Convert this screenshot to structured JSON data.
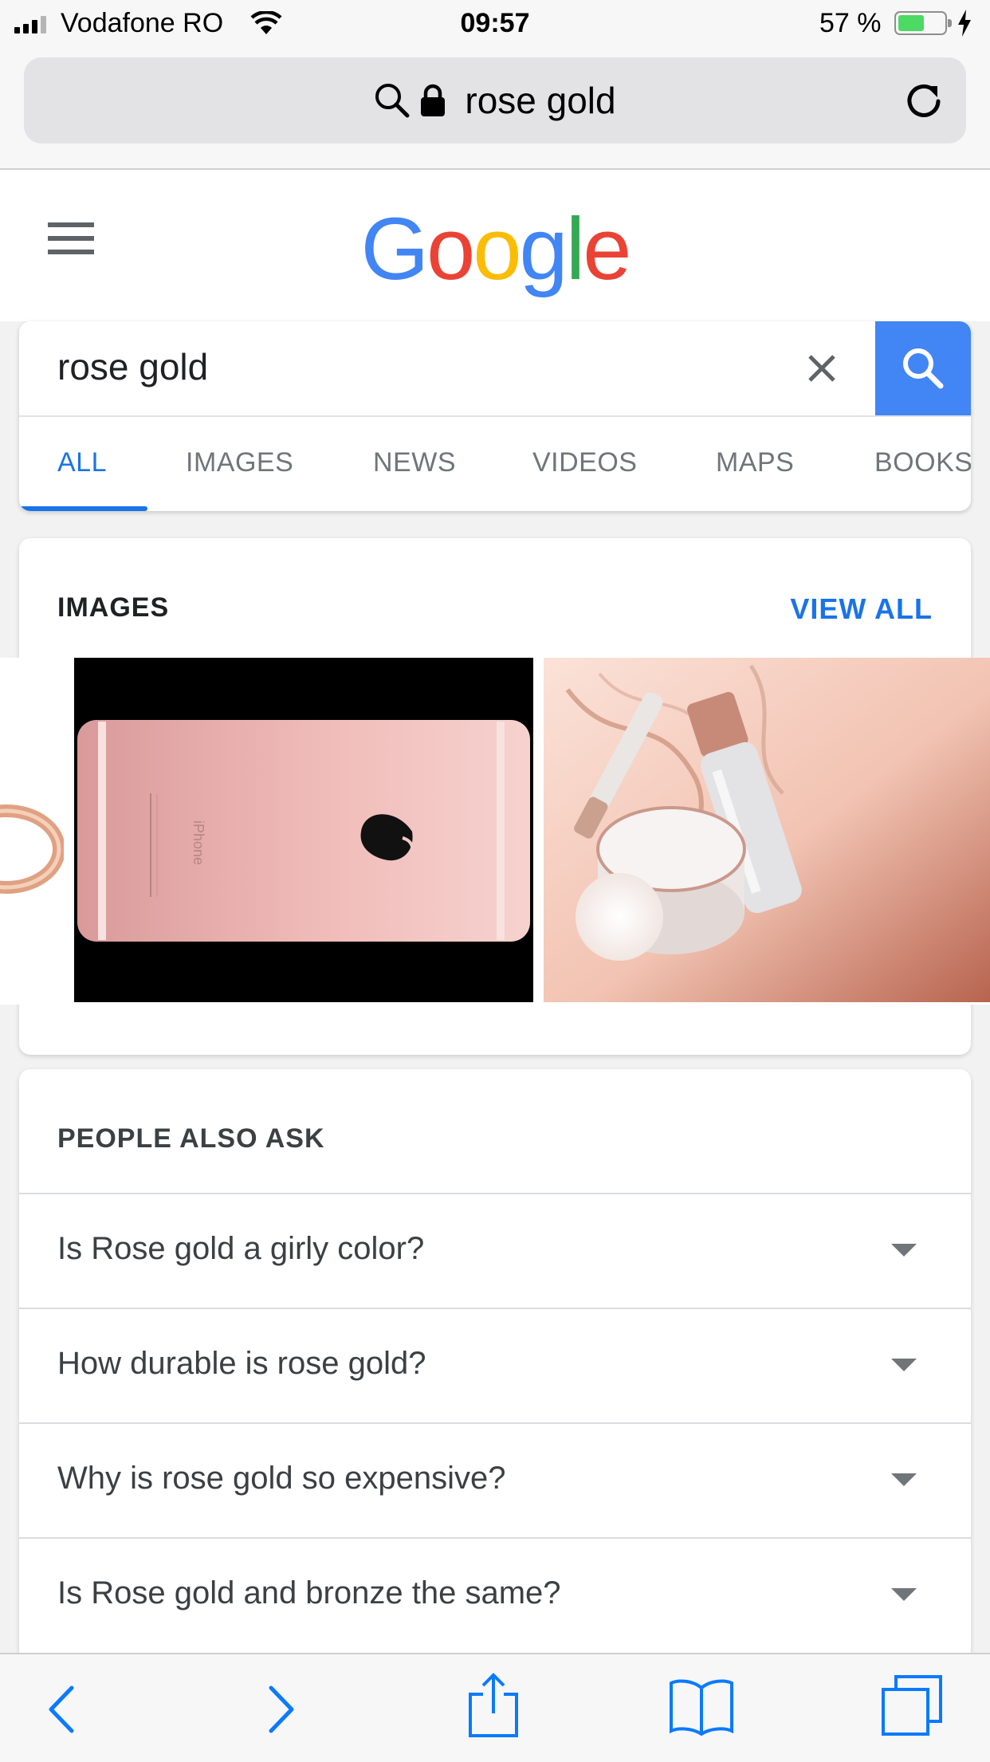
{
  "status_bar": {
    "carrier": "Vodafone RO",
    "time": "09:57",
    "battery_percent": "57 %",
    "battery_level": 0.57
  },
  "browser": {
    "url_text": "rose gold"
  },
  "google": {
    "logo_letters": [
      {
        "char": "G",
        "color": "#4285f4"
      },
      {
        "char": "o",
        "color": "#ea4335"
      },
      {
        "char": "o",
        "color": "#fbbc05"
      },
      {
        "char": "g",
        "color": "#4285f4"
      },
      {
        "char": "l",
        "color": "#34a853"
      },
      {
        "char": "e",
        "color": "#ea4335"
      }
    ],
    "search_query": "rose gold",
    "tabs": [
      {
        "label": "ALL",
        "active": true
      },
      {
        "label": "IMAGES",
        "active": false
      },
      {
        "label": "NEWS",
        "active": false
      },
      {
        "label": "VIDEOS",
        "active": false
      },
      {
        "label": "MAPS",
        "active": false
      },
      {
        "label": "BOOKS",
        "active": false
      }
    ]
  },
  "images_section": {
    "title": "IMAGES",
    "view_all": "VIEW ALL",
    "thumbnails": [
      "rose gold ring",
      "rose gold iPhone back",
      "rose gold cosmetics"
    ],
    "phone_engraving": "iPhone"
  },
  "people_also_ask": {
    "title": "PEOPLE ALSO ASK",
    "questions": [
      "Is Rose gold a girly color?",
      "How durable is rose gold?",
      "Why is rose gold so expensive?",
      "Is Rose gold and bronze the same?"
    ]
  },
  "colors": {
    "accent": "#1a73e8",
    "search_button": "#4285f4",
    "battery_fill": "#4cd964",
    "ios_blue": "#0a7aff"
  },
  "toolbar": {
    "icons": [
      "back-icon",
      "forward-icon",
      "share-icon",
      "bookmarks-icon",
      "tabs-icon"
    ]
  }
}
